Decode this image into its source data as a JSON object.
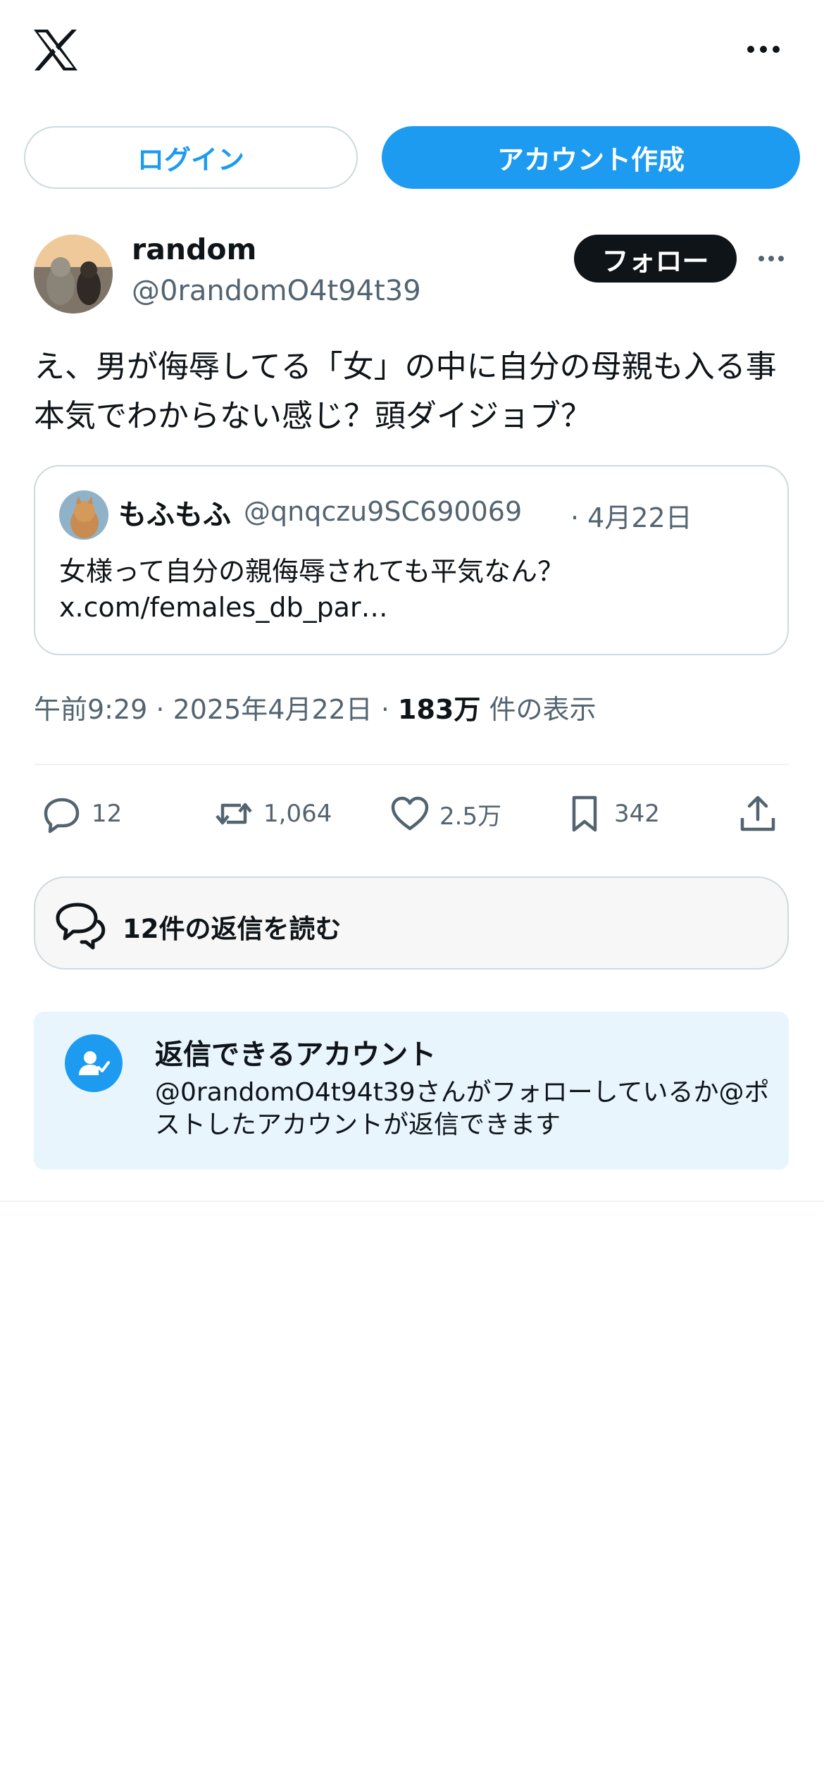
{
  "header": {
    "logo": "x-logo-icon",
    "more": "more-horizontal-icon"
  },
  "auth": {
    "login_label": "ログイン",
    "signup_label": "アカウント作成"
  },
  "post": {
    "author_name": "random",
    "author_handle": "@0randomO4t94t39",
    "follow_label": "フォロー",
    "text": "え、男が侮辱してる「女」の中に自分の母親も入る事本気でわからない感じ？頭ダイジョブ？",
    "quote": {
      "name": "もふもふ",
      "handle": "@qnqczu9SC690069",
      "date": "· 4月22日",
      "text_line1": "女様って自分の親侮辱されても平気なん？",
      "text_line2": "x.com/females_db_par…"
    },
    "meta": {
      "time_date": "午前9:29 · 2025年4月22日 · ",
      "views_count": "183万",
      "views_suffix": " 件の表示"
    },
    "actions": {
      "replies": "12",
      "reposts": "1,064",
      "likes": "2.5万",
      "bookmarks": "342"
    }
  },
  "read_replies_label": "12件の返信を読む",
  "who_can_reply": {
    "title": "返信できるアカウント",
    "desc": "@0randomO4t94t39さんがフォローしているか@ポストしたアカウントが返信できます"
  },
  "colors": {
    "accent": "#1d9bf0",
    "text": "#0f1419",
    "muted": "#536471",
    "border": "#cfd9de",
    "info_bg": "#e8f5fd"
  }
}
